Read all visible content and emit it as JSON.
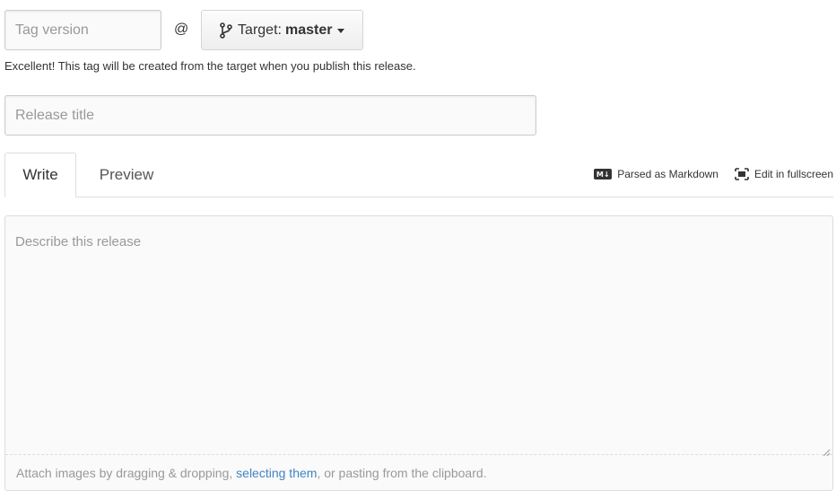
{
  "tag": {
    "placeholder": "Tag version",
    "at": "@",
    "target_label": "Target:",
    "target_value": "master",
    "note": "Excellent! This tag will be created from the target when you publish this release."
  },
  "release_title": {
    "placeholder": "Release title"
  },
  "tabs": {
    "write": "Write",
    "preview": "Preview"
  },
  "tools": {
    "markdown_badge": "M↓",
    "markdown_label": "Parsed as Markdown",
    "fullscreen_label": "Edit in fullscreen"
  },
  "editor": {
    "placeholder": "Describe this release",
    "drop_prefix": "Attach images by dragging & dropping, ",
    "drop_link": "selecting them",
    "drop_suffix": ", or pasting from the clipboard."
  },
  "icons": {
    "branch": "branch-icon",
    "markdown": "markdown-icon",
    "fullscreen": "fullscreen-icon",
    "caret": "caret-down-icon",
    "resize": "resize-handle-icon"
  }
}
